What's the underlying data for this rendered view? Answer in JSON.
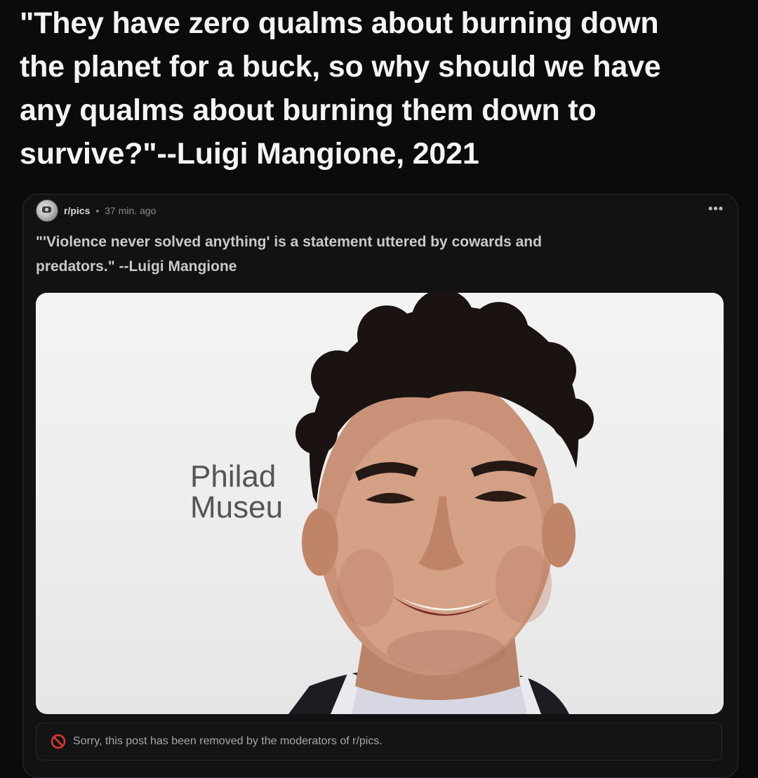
{
  "headline": {
    "line1": "\"They have zero qualms about burning down",
    "line2": "the planet for a buck, so why should we have",
    "line3": "any qualms about burning them down to",
    "line4": "survive?\"--Luigi Mangione, 2021"
  },
  "post": {
    "subreddit": "r/pics",
    "separator": "•",
    "time": "37 min. ago",
    "more": "•••",
    "title_line1": "\"'Violence never solved anything' is a statement uttered by cowards and",
    "title_line2": "predators.\" --Luigi Mangione",
    "image": {
      "backdrop_line1": "Philad",
      "backdrop_line2": "Museu"
    },
    "removed_notice": "Sorry, this post has been removed by the moderators of r/pics.",
    "removed_icon": "ban-icon",
    "colors": {
      "ban_icon": "#e0392b",
      "background": "#0b0b0c",
      "card": "#121214"
    }
  }
}
